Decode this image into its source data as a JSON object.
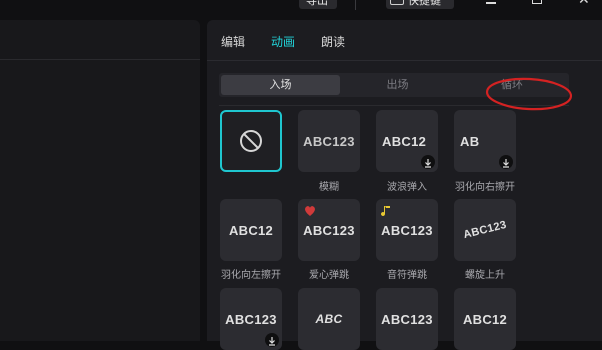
{
  "toolbar": {
    "export_label": "导出",
    "shortcut_label": "快捷键"
  },
  "tabs": [
    "编辑",
    "动画",
    "朗读"
  ],
  "active_tab": "动画",
  "segments": [
    "入场",
    "出场",
    "循环"
  ],
  "active_segment": "入场",
  "annotation_color": "#d42222",
  "accent_color": "#22d3d9",
  "grid": [
    {
      "label": "",
      "sample": "",
      "type": "none",
      "download": false
    },
    {
      "label": "模糊",
      "sample": "ABC123",
      "download": false
    },
    {
      "label": "波浪弹入",
      "sample": "ABC12",
      "download": true
    },
    {
      "label": "羽化向右擦开",
      "sample": "AB",
      "download": true
    },
    {
      "label": "羽化向左擦开",
      "sample": "ABC12",
      "download": false
    },
    {
      "label": "爱心弹跳",
      "sample": "ABC123",
      "download": false
    },
    {
      "label": "音符弹跳",
      "sample": "ABC123",
      "download": false
    },
    {
      "label": "螺旋上升",
      "sample": "ABC123",
      "download": false
    },
    {
      "label": "",
      "sample": "ABC123",
      "download": true
    },
    {
      "label": "",
      "sample": "ABC",
      "download": false
    },
    {
      "label": "",
      "sample": "ABC123",
      "download": false
    },
    {
      "label": "",
      "sample": "ABC12",
      "download": false
    }
  ]
}
